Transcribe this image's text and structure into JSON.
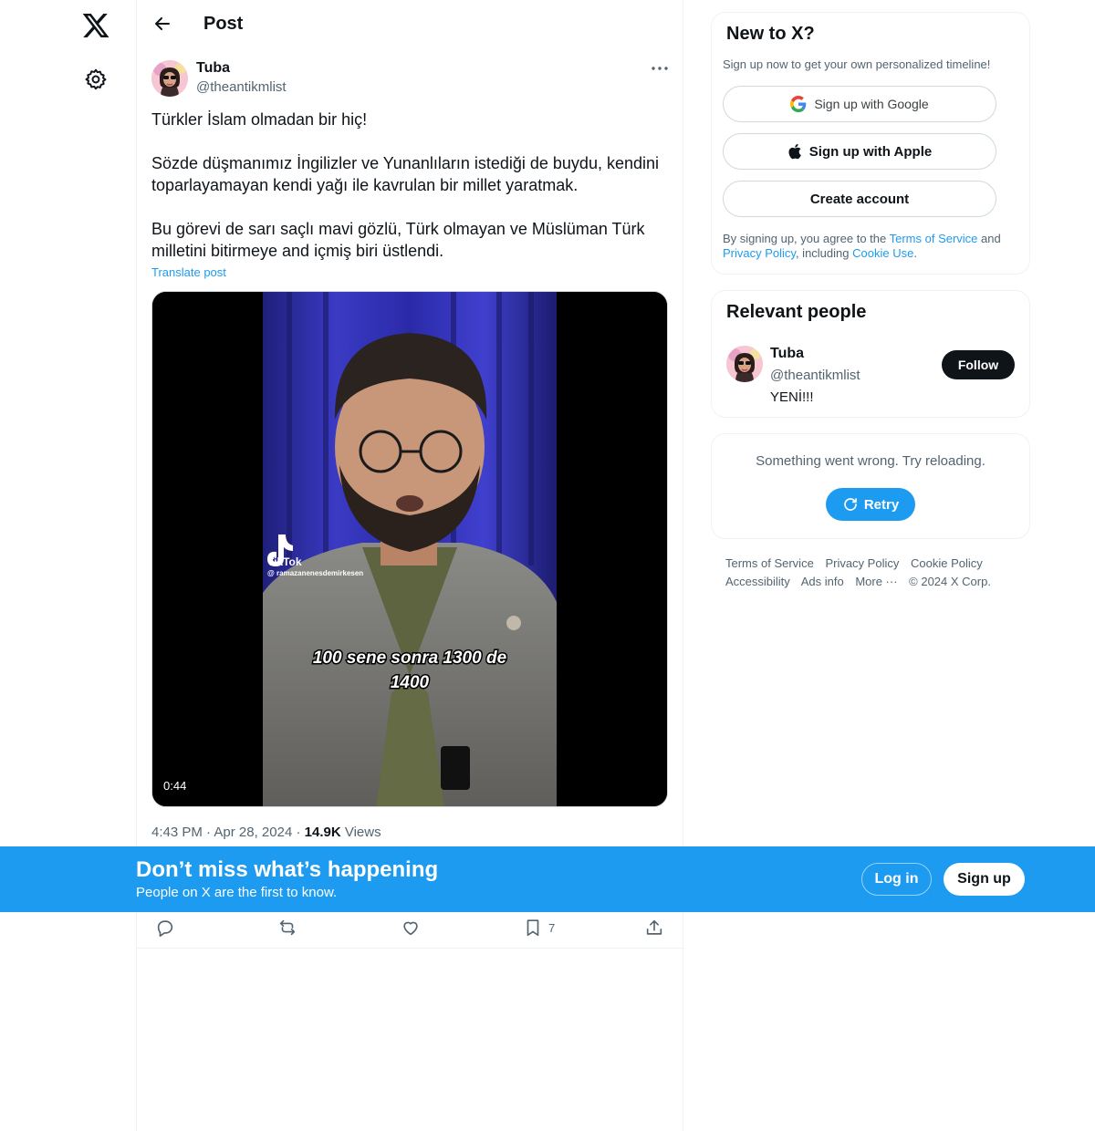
{
  "header": {
    "title": "Post"
  },
  "post": {
    "author_name": "Tuba",
    "author_handle": "@theantikmlist",
    "paragraphs": [
      "Türkler İslam olmadan bir hiç!",
      "Sözde düşmanımız İngilizler ve Yunanlıların istediği de buydu, kendini toparlayamayan kendi yağı ile kavrulan bir millet yaratmak.",
      "Bu görevi de sarı saçlı mavi gözlü, Türk olmayan ve Müslüman Türk milletini bitirmeye and içmiş biri üstlendi."
    ],
    "translate_label": "Translate post",
    "video": {
      "duration": "0:44",
      "watermark_brand": "TikTok",
      "watermark_user": "@ ramazanenesdemirkesen",
      "caption_line1": "100 sene sonra  1300 de",
      "caption_line2": "1400"
    },
    "time": "4:43 PM",
    "date": "Apr 28, 2024",
    "views_count": "14.9K",
    "views_label": "Views",
    "bookmark_count": "7"
  },
  "sidebar": {
    "new_to_x": {
      "title": "New to X?",
      "subtitle": "Sign up now to get your own personalized timeline!",
      "google_label": "Sign up with Google",
      "apple_label": "Sign up with Apple",
      "create_label": "Create account",
      "legal_prefix": "By signing up, you agree to the ",
      "terms_link": "Terms of Service",
      "legal_and": " and ",
      "privacy_link": "Privacy Policy",
      "legal_including": ", including ",
      "cookie_link": "Cookie Use",
      "legal_end": "."
    },
    "relevant_people": {
      "title": "Relevant people",
      "name": "Tuba",
      "handle": "@theantikmlist",
      "bio": "YENİ!!!",
      "follow_label": "Follow"
    },
    "error": {
      "message": "Something went wrong. Try reloading.",
      "retry_label": "Retry"
    },
    "footer": {
      "terms": "Terms of Service",
      "privacy": "Privacy Policy",
      "cookie": "Cookie Policy",
      "accessibility": "Accessibility",
      "ads": "Ads info",
      "more": "More ···",
      "copyright": "© 2024 X Corp."
    }
  },
  "banner": {
    "title": "Don’t miss what’s happening",
    "subtitle": "People on X are the first to know.",
    "login_label": "Log in",
    "signup_label": "Sign up"
  },
  "colors": {
    "accent": "#1d9bf0",
    "text": "#0f1419",
    "muted": "#536471",
    "border": "#eff3f4"
  }
}
